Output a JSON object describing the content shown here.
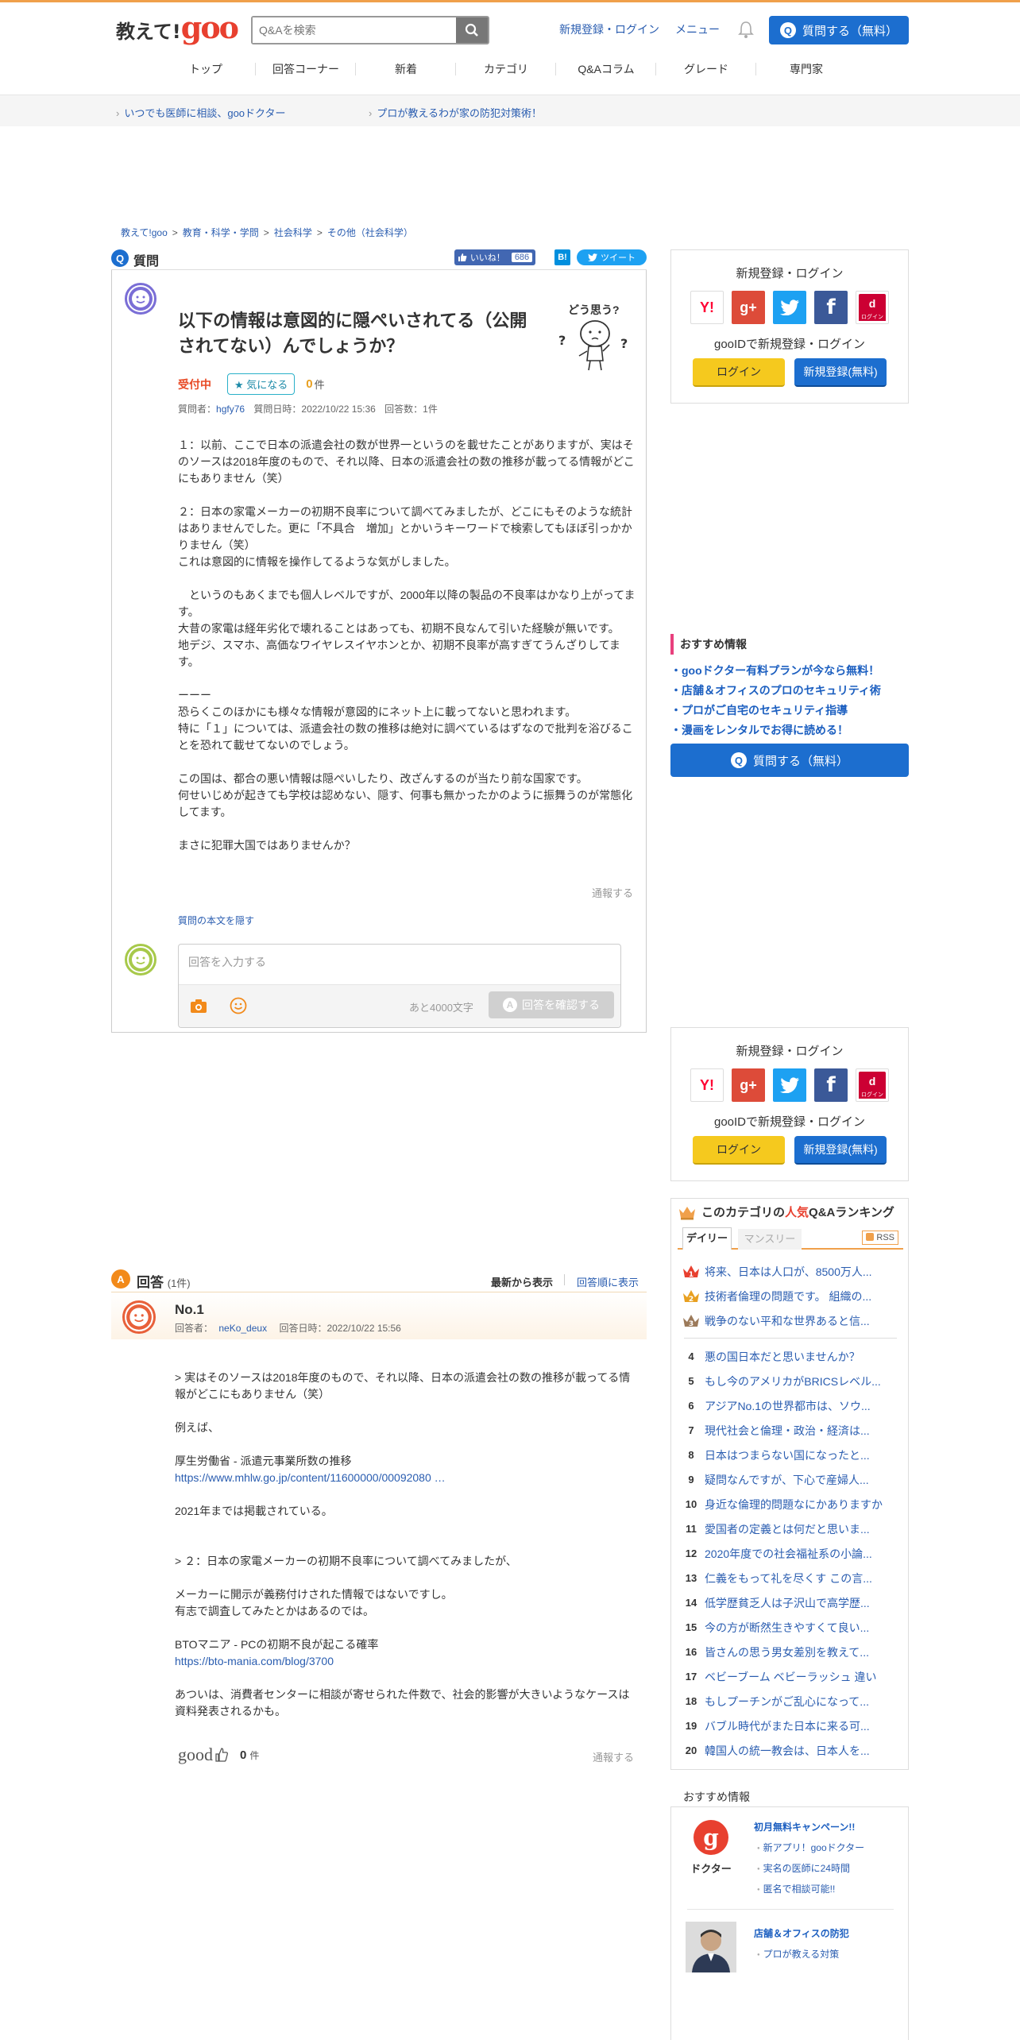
{
  "header": {
    "logo_part1": "教えて!",
    "logo_part2": "goo",
    "search_placeholder": "Q&Aを検索",
    "login_link": "新規登録・ログイン",
    "menu_link": "メニュー",
    "ask_button": "質問する（無料）",
    "ask_icon_glyph": "Q"
  },
  "nav": [
    "トップ",
    "回答コーナー",
    "新着",
    "カテゴリ",
    "Q&Aコラム",
    "グレード",
    "専門家"
  ],
  "promo": {
    "link1": "いつでも医師に相談、gooドクター",
    "link2": "プロが教えるわが家の防犯対策術！"
  },
  "breadcrumb": [
    "教えて!goo",
    "教育・科学・学問",
    "社会科学",
    "その他（社会科学）"
  ],
  "breadcrumb_sep": ">",
  "question": {
    "section_label": "質問",
    "icon_glyph": "Q",
    "like_label": "いいね！",
    "like_count": "686",
    "hatebu_glyph": "B!",
    "tweet_label": "ツイート",
    "title": "以下の情報は意図的に隠ぺいされてる（公開されてない）んでしょうか？",
    "doomou_label": "どう思う?",
    "status": "受付中",
    "kininaru": "気になる",
    "kininaru_count": "0",
    "count_unit": "件",
    "meta_asker_label": "質問者：",
    "asker": "hgfy76",
    "meta_date": "質問日時：2022/10/22 15:36",
    "meta_answers": "回答数：1件",
    "body": "１：以前、ここで日本の派遣会社の数が世界一というのを載せたことがありますが、実はそのソースは2018年度のもので、それ以降、日本の派遣会社の数の推移が載ってる情報がどこにもありません（笑）\n\n２：日本の家電メーカーの初期不良率について調べてみましたが、どこにもそのような統計はありませんでした。更に「不具合　増加」とかいうキーワードで検索してもほぼ引っかかりません（笑）\nこれは意図的に情報を操作してるような気がしました。\n\n　というのもあくまでも個人レベルですが、2000年以降の製品の不良率はかなり上がってます。\n大昔の家電は経年劣化で壊れることはあっても、初期不良なんて引いた経験が無いです。\n地デジ、スマホ、高価なワイヤレスイヤホンとか、初期不良率が高すぎてうんざりしてます。\n\nーーー\n恐らくこのほかにも様々な情報が意図的にネット上に載ってないと思われます。\n特に「１」については、派遣会社の数の推移は絶対に調べているはずなので批判を浴びることを恐れて載せてないのでしょう。\n\nこの国は、都合の悪い情報は隠ぺいしたり、改ざんするのが当たり前な国家です。\n何せいじめが起きても学校は認めない、隠す、何事も無かったかのように振舞うのが常態化してます。\n\nまさに犯罪大国ではありませんか？",
    "report": "通報する",
    "hide_link": "質問の本文を隠す",
    "answer_placeholder": "回答を入力する",
    "char_remaining": "あと4000文字",
    "confirm_button": "回答を確認する",
    "confirm_icon_glyph": "A"
  },
  "sidebar": {
    "login_title": "新規登録・ログイン",
    "gooid_text": "gooIDで新規登録・ログイン",
    "login_button": "ログイン",
    "register_button": "新規登録(無料)",
    "sns": [
      {
        "name": "yahoo-icon",
        "glyph": "Y!",
        "color": "#ff0033"
      },
      {
        "name": "google-plus-icon",
        "glyph": "g+",
        "color": "#dd4b39"
      },
      {
        "name": "twitter-icon",
        "glyph": "t",
        "color": "#1da1f2"
      },
      {
        "name": "facebook-icon",
        "glyph": "f",
        "color": "#3b5998"
      },
      {
        "name": "docomo-icon",
        "glyph": "d",
        "color": "#cc0033",
        "sub": "ログイン"
      }
    ],
    "reco_title": "おすすめ情報",
    "reco_items": [
      "・gooドクター有料プランが今なら無料！",
      "・店舗＆オフィスのプロのセキュリティ術",
      "・プロがご自宅のセキュリティ指導",
      "・漫画をレンタルでお得に読める！"
    ],
    "ask_button": "質問する（無料）"
  },
  "answers": {
    "section_label": "回答",
    "icon_glyph": "A",
    "count": "(1件)",
    "sort_latest": "最新から表示",
    "sort_order": "回答順に表示",
    "items": [
      {
        "no": "No.1",
        "answerer_label": "回答者：",
        "answerer": "neKo_deux",
        "date": "回答日時：2022/10/22 15:56",
        "body_parts": [
          "> 実はそのソースは2018年度のもので、それ以降、日本の派遣会社の数の推移が載ってる情報がどこにもありません（笑）\n\n例えば、\n\n厚生労働省 - 派遣元事業所数の推移",
          "https://www.mhlw.go.jp/content/11600000/00092080 …",
          "\n\n2021年までは掲載されている。\n\n\n> ２：日本の家電メーカーの初期不良率について調べてみましたが、\n\nメーカーに開示が義務付けされた情報ではないですし。\n有志で調査してみたとかはあるのでは。\n\nBTOマニア - PCの初期不良が起こる確率",
          "https://bto-mania.com/blog/3700",
          "\n\nあついは、消費者センターに相談が寄せられた件数で、社会的影響が大きいようなケースは資料発表されるかも。"
        ],
        "good_label": "good",
        "good_count": "0",
        "good_unit": "件",
        "report": "通報する"
      }
    ]
  },
  "ranking": {
    "title_pre": "このカテゴリの",
    "title_hl": "人気",
    "title_post": "Q&Aランキング",
    "tab_daily": "デイリー",
    "tab_monthly": "マンスリー",
    "rss": "RSS",
    "items": [
      {
        "rank": "1",
        "text": "将来、日本は人口が、8500万人..."
      },
      {
        "rank": "2",
        "text": "技術者倫理の問題です。 組織の..."
      },
      {
        "rank": "3",
        "text": "戦争のない平和な世界あると信..."
      },
      {
        "rank": "4",
        "text": "悪の国日本だと思いませんか？"
      },
      {
        "rank": "5",
        "text": "もし今のアメリカがBRICSレベル..."
      },
      {
        "rank": "6",
        "text": "アジアNo.1の世界都市は、ソウ..."
      },
      {
        "rank": "7",
        "text": "現代社会と倫理・政治・経済は..."
      },
      {
        "rank": "8",
        "text": "日本はつまらない国になったと..."
      },
      {
        "rank": "9",
        "text": "疑問なんですが、下心で産婦人..."
      },
      {
        "rank": "10",
        "text": "身近な倫理的問題なにかありますか"
      },
      {
        "rank": "11",
        "text": "愛国者の定義とは何だと思いま..."
      },
      {
        "rank": "12",
        "text": "2020年度での社会福祉系の小論..."
      },
      {
        "rank": "13",
        "text": "仁義をもって礼を尽くす この言..."
      },
      {
        "rank": "14",
        "text": "低学歴貧乏人は子沢山で高学歴..."
      },
      {
        "rank": "15",
        "text": "今の方が断然生きやすくて良い..."
      },
      {
        "rank": "16",
        "text": "皆さんの思う男女差別を教えて..."
      },
      {
        "rank": "17",
        "text": "ベビーブーム ベビーラッシュ 違い"
      },
      {
        "rank": "18",
        "text": "もしプーチンがご乱心になって..."
      },
      {
        "rank": "19",
        "text": "バブル時代がまた日本に来る可..."
      },
      {
        "rank": "20",
        "text": "韓国人の統一教会は、日本人を..."
      }
    ]
  },
  "osusume2": {
    "title": "おすすめ情報",
    "item1_title": "初月無料キャンペーン!!",
    "item1_subs": [
      "新アプリ！gooドクター",
      "実名の医師に24時間",
      "匿名で相談可能!!"
    ],
    "doctor_logo": "ドクター",
    "item2_title": "店舗＆オフィスの防犯",
    "item2_subs": [
      "プロが教える対策"
    ]
  },
  "colors": {
    "accent_blue": "#1c6ecf",
    "brand_red": "#e8402f",
    "top_stripe": "#f0a04b",
    "answer_orange": "#f28a1a"
  }
}
